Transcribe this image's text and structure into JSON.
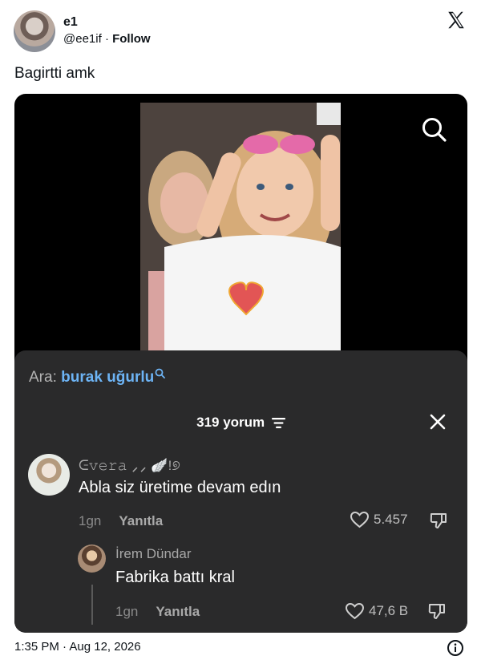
{
  "author": {
    "name": "e1",
    "handle": "@ee1if",
    "separator": "·",
    "follow_label": "Follow"
  },
  "tweet": {
    "text": "Bagirtti amk",
    "timestamp": "1:35 PM · Aug 12, 2026"
  },
  "comments_panel": {
    "search_prefix": "Ara:",
    "search_query": "burak uğurlu",
    "comment_count": "319 yorum",
    "comments": [
      {
        "username": "ᕮ𝚟𝚎𝚛𝚊 ⸝⸝ 🪽!୭",
        "text": "Abla siz üretime devam edın",
        "time": "1gn",
        "reply_label": "Yanıtla",
        "likes": "5.457"
      },
      {
        "username": "İrem Dündar",
        "text": "Fabrika battı kral",
        "time": "1gn",
        "reply_label": "Yanıtla",
        "likes": "47,6 B"
      }
    ]
  },
  "icons": {
    "x_logo": "x-logo-icon",
    "video_search": "search-icon",
    "sort": "sort-icon",
    "close": "close-icon",
    "like": "heart-icon",
    "dislike": "dislike-icon",
    "info": "info-icon"
  },
  "colors": {
    "search_query": "#6db4f5",
    "panel_bg": "#2a2a2b",
    "media_bg": "#000000"
  }
}
